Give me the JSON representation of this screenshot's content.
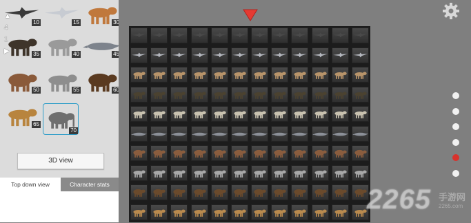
{
  "sidebar": {
    "animals": [
      {
        "name": "eagle",
        "level": "10"
      },
      {
        "name": "seagull",
        "level": "15"
      },
      {
        "name": "fox",
        "level": "30"
      },
      {
        "name": "boar",
        "level": "35"
      },
      {
        "name": "wolf",
        "level": "40"
      },
      {
        "name": "crocodile",
        "level": "45"
      },
      {
        "name": "hippo",
        "level": "50"
      },
      {
        "name": "rhino",
        "level": "55"
      },
      {
        "name": "bear",
        "level": "60"
      },
      {
        "name": "lion",
        "level": "65"
      },
      {
        "name": "elephant",
        "level": "70"
      }
    ],
    "side_icons": [
      "arrow-up-icon",
      "4",
      "1",
      "play-icon"
    ],
    "view_button": "3D view",
    "tabs": {
      "top_down": "Top down view",
      "character_stats": "Character stats"
    }
  },
  "grid": {
    "columns": 12,
    "rows": [
      {
        "animal": "eagle",
        "color": "#4a4a4a"
      },
      {
        "animal": "seagull",
        "color": "#b5b8bf"
      },
      {
        "animal": "fox",
        "color": "#b8946a"
      },
      {
        "animal": "boar",
        "color": "#4b4230"
      },
      {
        "animal": "wolf",
        "color": "#c9c2b0"
      },
      {
        "animal": "crocodile",
        "color": "#8c9098"
      },
      {
        "animal": "hippo",
        "color": "#8a5d3e"
      },
      {
        "animal": "rhino",
        "color": "#a8a8a8"
      },
      {
        "animal": "bear",
        "color": "#6a4a2c"
      },
      {
        "animal": "lion",
        "color": "#b98a4e"
      }
    ]
  },
  "pager": {
    "count": 6,
    "active_index": 4,
    "active_color": "#d8322c"
  },
  "watermark": {
    "number": "2265",
    "chinese": "手游网",
    "url": "2265.com"
  }
}
